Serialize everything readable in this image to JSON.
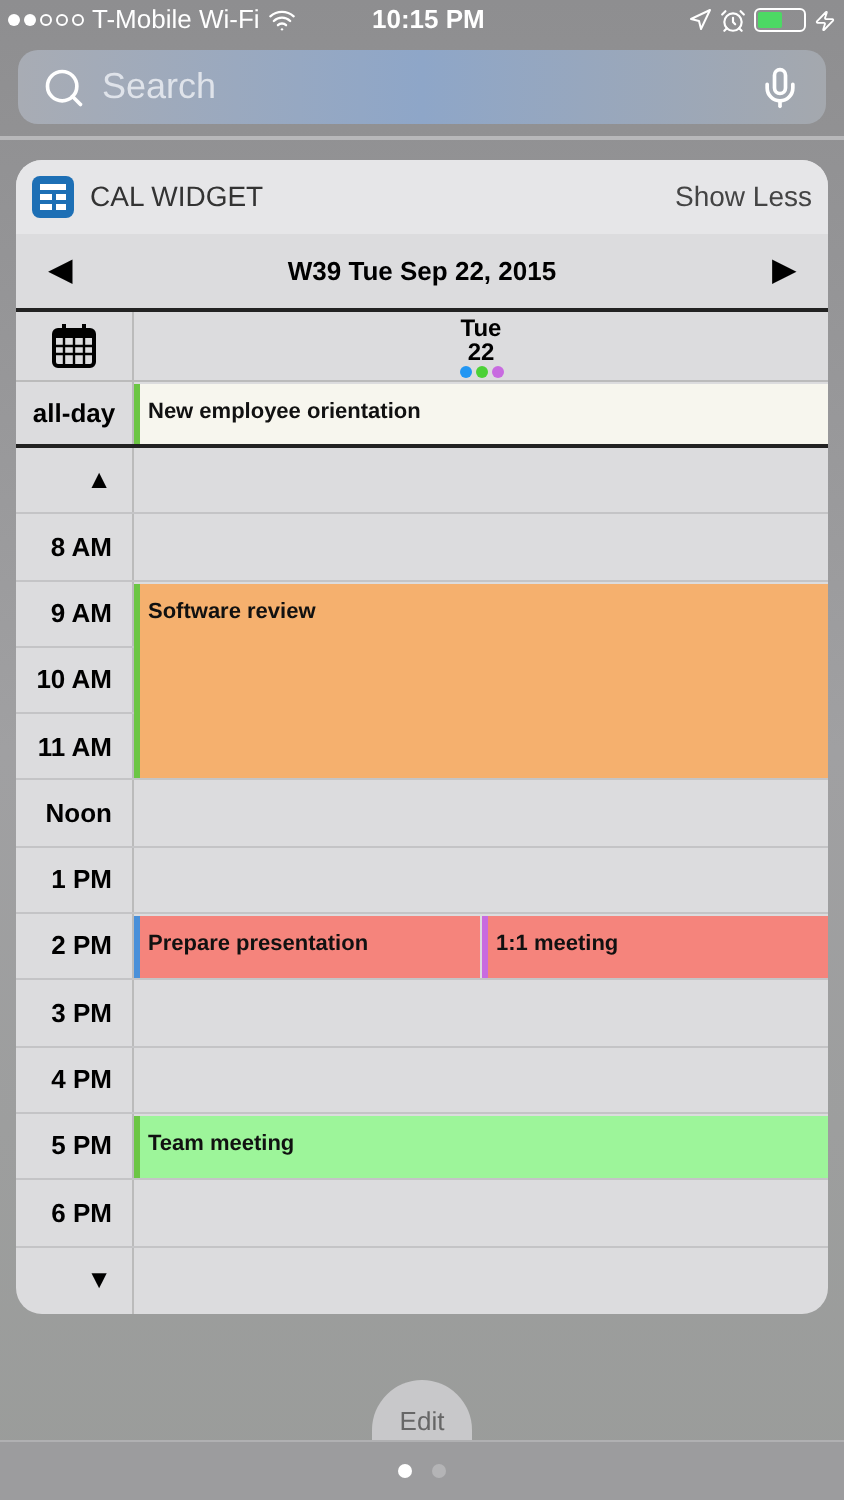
{
  "status_bar": {
    "carrier": "T-Mobile Wi-Fi",
    "time": "10:15 PM"
  },
  "search": {
    "placeholder": "Search"
  },
  "widget": {
    "title": "CAL WIDGET",
    "action": "Show Less"
  },
  "nav": {
    "prev": "◀",
    "title": "W39 Tue Sep 22, 2015",
    "next": "▶"
  },
  "day_header": {
    "weekday": "Tue",
    "day": "22",
    "dots": [
      {
        "color": "#2196f3"
      },
      {
        "color": "#4cd137"
      },
      {
        "color": "#c86be0"
      }
    ]
  },
  "all_day": {
    "label": "all-day",
    "events": [
      {
        "title": "New employee orientation",
        "color": "#f7f6ee",
        "calendar": {
          "color": "#6cc644"
        }
      }
    ]
  },
  "rows": [
    {
      "label": "▲",
      "events": []
    },
    {
      "label": "8 AM",
      "events": []
    },
    {
      "label": "9 AM",
      "events": [
        {
          "title": "Software review",
          "color": "#f5b06e",
          "calendar": {
            "color": "#6cc644"
          },
          "kind": "start"
        }
      ]
    },
    {
      "label": "10 AM",
      "events": [
        {
          "color": "#f5b06e",
          "calendar": {
            "color": "#6cc644"
          },
          "kind": "continued"
        }
      ]
    },
    {
      "label": "11 AM",
      "events": [
        {
          "color": "#f5b06e",
          "calendar": {
            "color": "#6cc644"
          },
          "kind": "continued"
        }
      ]
    },
    {
      "label": "Noon",
      "events": []
    },
    {
      "label": "1 PM",
      "events": []
    },
    {
      "label": "2 PM",
      "events": [
        {
          "title": "Prepare presentation",
          "color": "#f5847c",
          "calendar": {
            "color": "#4a90d9"
          },
          "kind": "start"
        },
        {
          "title": "1:1 meeting",
          "color": "#f5847c",
          "calendar": {
            "color": "#c86be0"
          },
          "kind": "start"
        }
      ]
    },
    {
      "label": "3 PM",
      "events": []
    },
    {
      "label": "4 PM",
      "events": []
    },
    {
      "label": "5 PM",
      "events": [
        {
          "title": "Team meeting",
          "color": "#9df59a",
          "calendar": {
            "color": "#6cc644"
          },
          "kind": "start"
        }
      ]
    },
    {
      "label": "6 PM",
      "events": []
    },
    {
      "label": "▼",
      "events": []
    }
  ],
  "footer": {
    "edit": "Edit",
    "pages": [
      {
        "selected": true
      },
      {
        "selected": false
      }
    ]
  }
}
